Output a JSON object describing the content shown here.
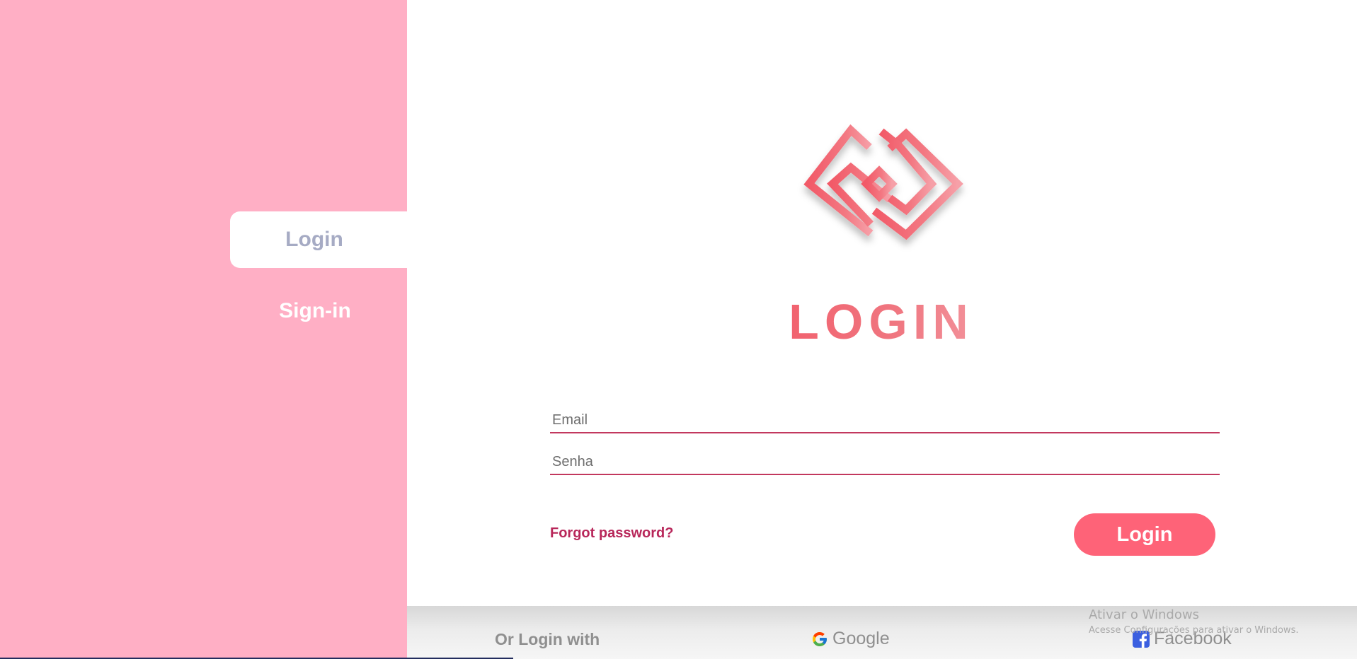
{
  "sidebar": {
    "tabs": [
      {
        "label": "Login",
        "active": true
      },
      {
        "label": "Sign-in",
        "active": false
      }
    ],
    "background_color": "#ffafc5"
  },
  "main": {
    "logo_icon": "geometric-maze-logo",
    "title": "LOGIN",
    "form": {
      "email_placeholder": "Email",
      "email_value": "",
      "password_placeholder": "Senha",
      "password_value": "",
      "forgot_password_label": "Forgot password?",
      "login_button_label": "Login"
    }
  },
  "footer": {
    "or_login_label": "Or Login with",
    "providers": [
      {
        "label": "Google",
        "icon": "google-g-icon"
      },
      {
        "label": "Facebook",
        "icon": "facebook-f-icon"
      }
    ]
  },
  "watermark": {
    "title": "Ativar o Windows",
    "subtitle": "Acesse Configurações para ativar o Windows."
  },
  "colors": {
    "accent": "#fe6378",
    "underline": "#c2385e",
    "link": "#b8275a",
    "tab_inactive_text": "#a6abc4"
  }
}
